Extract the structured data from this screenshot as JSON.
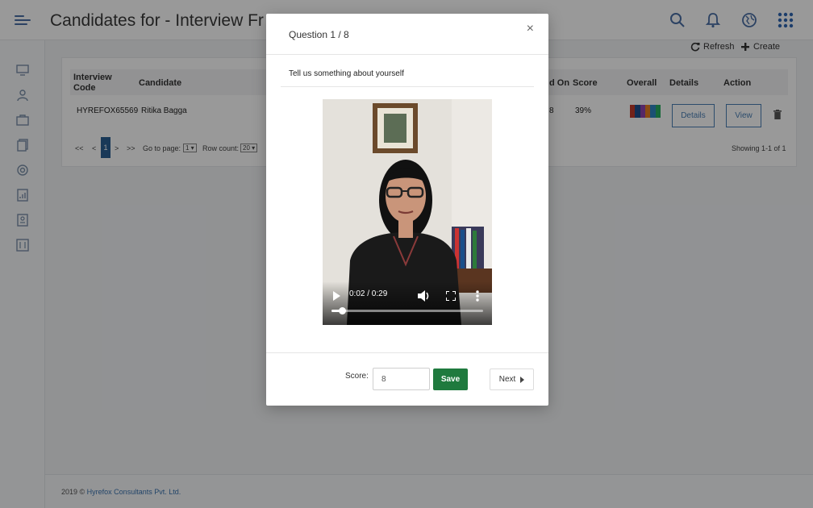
{
  "header": {
    "title": "Candidates for - Interview Fr"
  },
  "actions": {
    "refresh_label": "Refresh",
    "create_label": "Create"
  },
  "table": {
    "columns": {
      "interview_code": "Interview Code",
      "candidate": "Candidate",
      "scheduled_on": "d On",
      "score": "Score",
      "overall": "Overall",
      "details": "Details",
      "action": "Action"
    },
    "rows": [
      {
        "interview_code": "HYREFOX65569",
        "candidate": "Ritika Bagga",
        "scheduled_on": "8",
        "score": "39%",
        "details_button": "Details",
        "view_button": "View"
      }
    ],
    "overall_colors": [
      "#c0392b",
      "#1f4e8c",
      "#8e44ad",
      "#e67e22",
      "#2e86c1",
      "#27ae60"
    ]
  },
  "pagination": {
    "first": "<<",
    "prev": "<",
    "current_page": "1",
    "next": ">",
    "last": ">>",
    "go_to_label": "Go to page:",
    "go_to_value": "1",
    "row_count_label": "Row count:",
    "row_count_value": "20",
    "summary": "Showing 1-1 of 1"
  },
  "footer": {
    "prefix": "2019 ©",
    "company": "Hyrefox Consultants Pvt. Ltd."
  },
  "modal": {
    "title": "Question 1 / 8",
    "close": "×",
    "question": "Tell us something about yourself",
    "video": {
      "time": "0:02 / 0:29",
      "progress_fraction": 0.069
    },
    "score_label": "Score:",
    "score_value": "8",
    "save_label": "Save",
    "next_label": "Next"
  },
  "colors": {
    "primary": "#2b5f93",
    "save_green": "#1f7a3e",
    "link_blue": "#3a73b0"
  }
}
